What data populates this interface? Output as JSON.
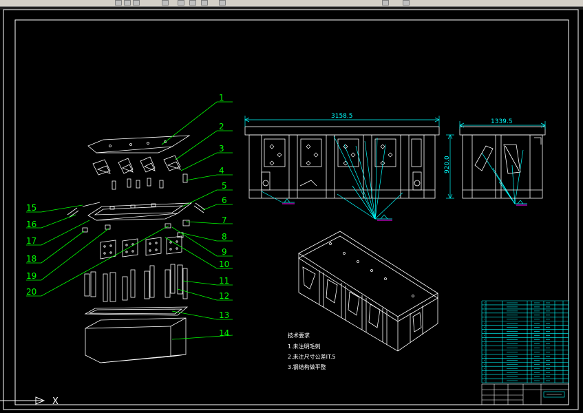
{
  "callouts": [
    "1",
    "2",
    "3",
    "4",
    "5",
    "6",
    "7",
    "8",
    "9",
    "10",
    "11",
    "12",
    "13",
    "14",
    "15",
    "16",
    "17",
    "18",
    "19",
    "20"
  ],
  "dimensions": {
    "front_width": "3158.5",
    "front_height": "920.0",
    "side_width": "1339.5"
  },
  "notes": {
    "title": "技术要求",
    "line1": "1.未注明毛刺",
    "line2": "2.未注尺寸公差IT.5",
    "line3": "3.钢结构做平整"
  },
  "axis": {
    "x_label": "X"
  },
  "colors": {
    "frame": "#ffffff",
    "leader": "#00ff00",
    "table": "#00ffff",
    "dim": "#00ffff",
    "accent": "#ff00ff"
  }
}
